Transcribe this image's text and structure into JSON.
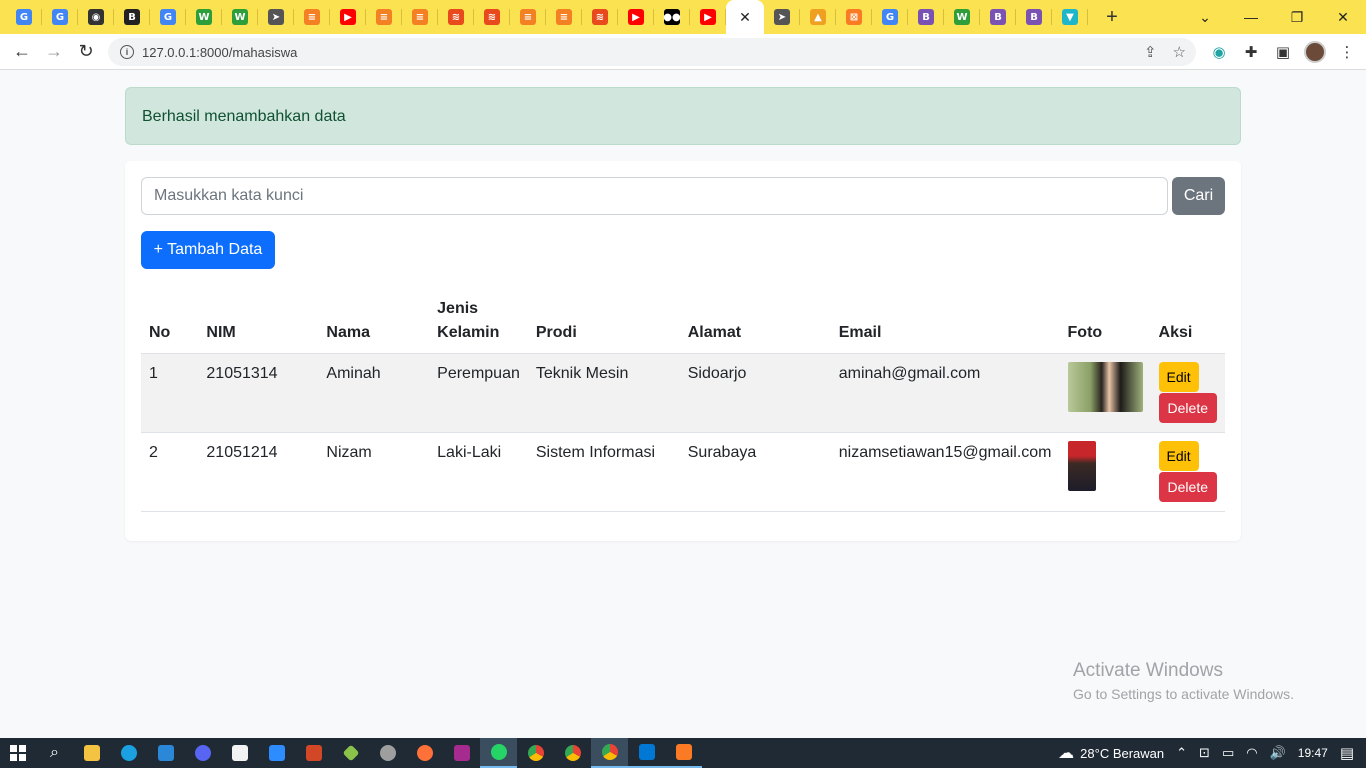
{
  "browser": {
    "tabs": [
      {
        "icon": "google-icon",
        "color": "#4285f4",
        "glyph": "G"
      },
      {
        "icon": "google-icon",
        "color": "#4285f4",
        "glyph": "G"
      },
      {
        "icon": "circle-logo-icon",
        "color": "#333333",
        "glyph": "◉"
      },
      {
        "icon": "bootstrap-icon",
        "color": "#222222",
        "glyph": "B"
      },
      {
        "icon": "google-icon",
        "color": "#4285f4",
        "glyph": "G"
      },
      {
        "icon": "w-icon",
        "color": "#2e9e3a",
        "glyph": "W"
      },
      {
        "icon": "w-icon",
        "color": "#2e9e3a",
        "glyph": "W"
      },
      {
        "icon": "paper-plane-icon",
        "color": "#555555",
        "glyph": "➤"
      },
      {
        "icon": "stack-icon",
        "color": "#f48024",
        "glyph": "≡"
      },
      {
        "icon": "youtube-icon",
        "color": "#ff0000",
        "glyph": "▶"
      },
      {
        "icon": "stack-icon",
        "color": "#f48024",
        "glyph": "≡"
      },
      {
        "icon": "stack-icon",
        "color": "#f48024",
        "glyph": "≡"
      },
      {
        "icon": "wifi-icon",
        "color": "#e8491d",
        "glyph": "≋"
      },
      {
        "icon": "wifi-icon",
        "color": "#e8491d",
        "glyph": "≋"
      },
      {
        "icon": "stack-icon",
        "color": "#f48024",
        "glyph": "≡"
      },
      {
        "icon": "stack-icon",
        "color": "#f48024",
        "glyph": "≡"
      },
      {
        "icon": "wifi-icon",
        "color": "#e8491d",
        "glyph": "≋"
      },
      {
        "icon": "youtube-icon",
        "color": "#ff0000",
        "glyph": "▶"
      },
      {
        "icon": "medium-icon",
        "color": "#000000",
        "glyph": "●●"
      },
      {
        "icon": "youtube-icon",
        "color": "#ff0000",
        "glyph": "▶"
      },
      {
        "icon": "close-icon",
        "color": "#ffffff",
        "glyph": "✕",
        "active": true
      },
      {
        "icon": "paper-plane-icon",
        "color": "#555555",
        "glyph": "➤"
      },
      {
        "icon": "pma-icon",
        "color": "#f0a020",
        "glyph": "▲"
      },
      {
        "icon": "xampp-icon",
        "color": "#fb7a24",
        "glyph": "⊠"
      },
      {
        "icon": "google-icon",
        "color": "#4285f4",
        "glyph": "G"
      },
      {
        "icon": "bootstrap-icon",
        "color": "#7952b3",
        "glyph": "B"
      },
      {
        "icon": "w-icon",
        "color": "#2e9e3a",
        "glyph": "W"
      },
      {
        "icon": "bootstrap-icon",
        "color": "#7952b3",
        "glyph": "B"
      },
      {
        "icon": "bootstrap-icon",
        "color": "#7952b3",
        "glyph": "B"
      },
      {
        "icon": "vue-tab-icon",
        "color": "#1fb6c9",
        "glyph": "▼"
      }
    ],
    "url": "127.0.0.1:8000/mahasiswa"
  },
  "alert": {
    "message": "Berhasil menambahkan data"
  },
  "search": {
    "placeholder": "Masukkan kata kunci",
    "button": "Cari"
  },
  "add_button": "+ Tambah Data",
  "table": {
    "headers": [
      "No",
      "NIM",
      "Nama",
      "Jenis Kelamin",
      "Prodi",
      "Alamat",
      "Email",
      "Foto",
      "Aksi"
    ],
    "rows": [
      {
        "no": "1",
        "nim": "21051314",
        "nama": "Aminah",
        "jk": "Perempuan",
        "prodi": "Teknik Mesin",
        "alamat": "Sidoarjo",
        "email": "aminah@gmail.com"
      },
      {
        "no": "2",
        "nim": "21051214",
        "nama": "Nizam",
        "jk": "Laki-Laki",
        "prodi": "Sistem Informasi",
        "alamat": "Surabaya",
        "email": "nizamsetiawan15@gmail.com"
      }
    ],
    "edit_label": "Edit",
    "delete_label": "Delete"
  },
  "watermark": {
    "line1": "Activate Windows",
    "line2": "Go to Settings to activate Windows."
  },
  "taskbar": {
    "weather": "28°C  Berawan",
    "time": "19:47"
  },
  "colors": {
    "primary": "#0d6efd",
    "secondary": "#6c757d",
    "warning": "#ffc107",
    "danger": "#dc3545",
    "success_bg": "#d1e7dd",
    "tabstrip": "#fbe251"
  }
}
